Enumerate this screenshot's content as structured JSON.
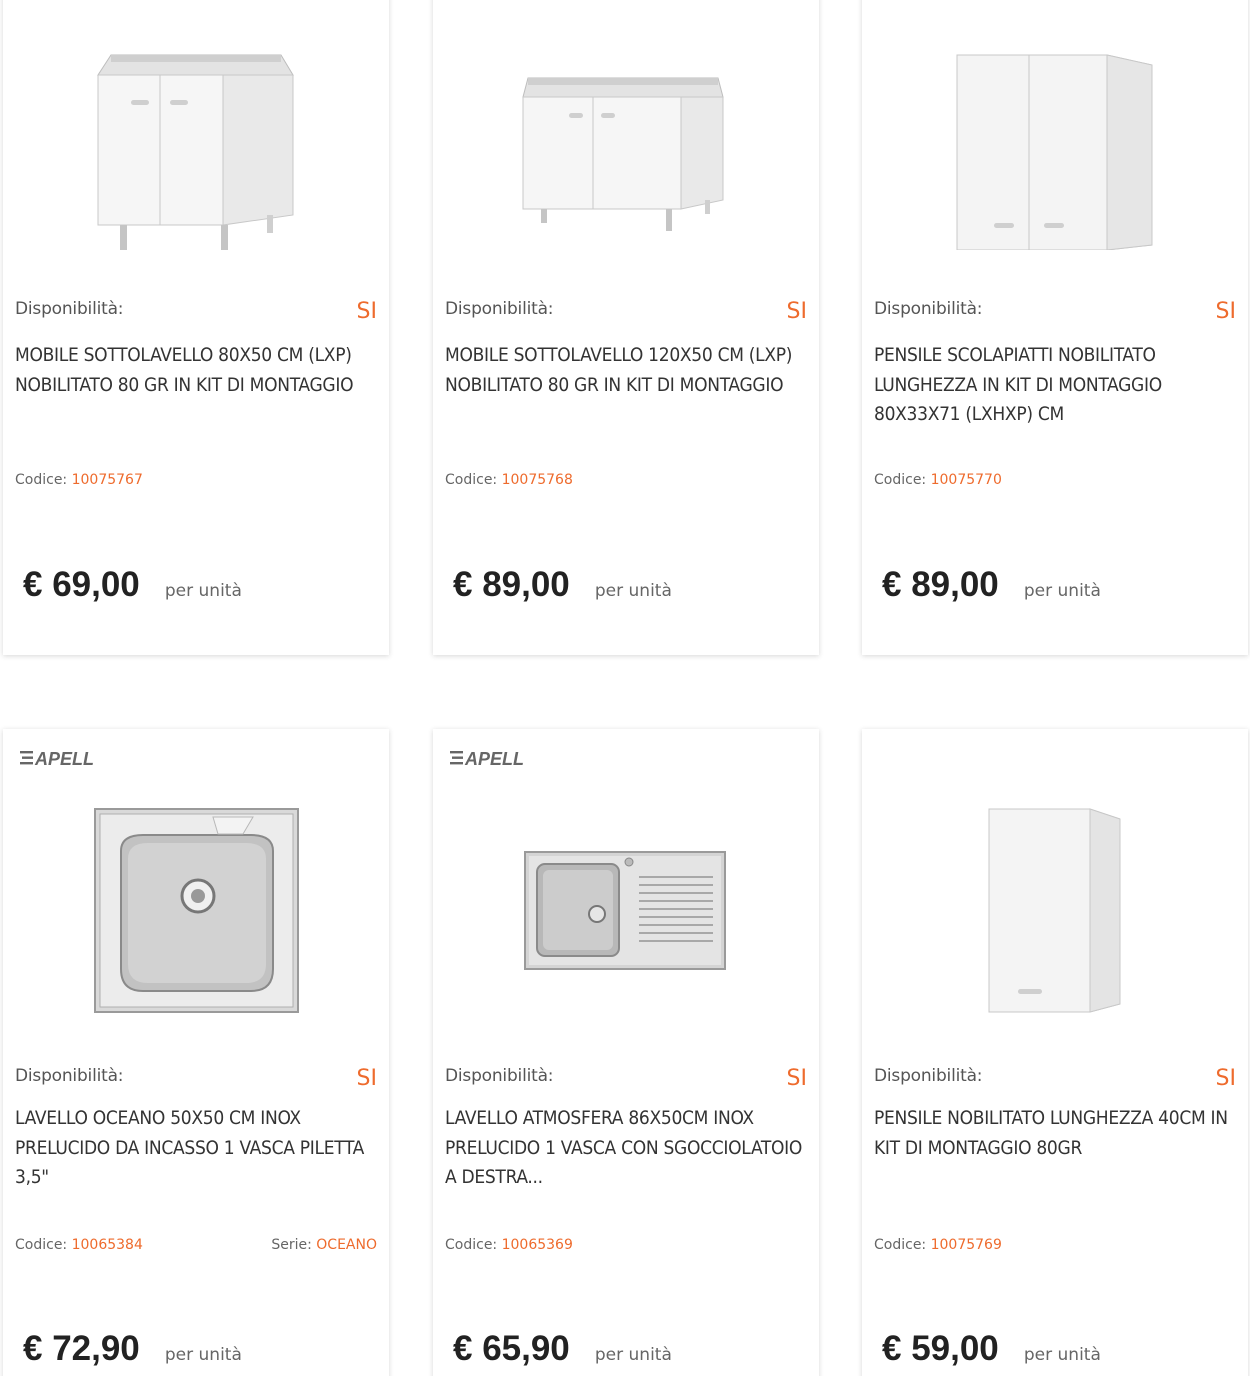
{
  "products": [
    {
      "availability_label": "Disponibilità:",
      "availability_value": "SI",
      "title": "MOBILE SOTTOLAVELLO 80X50 CM (LXP) NOBILITATO 80 GR IN KIT DI MONTAGGIO",
      "code_label": "Codice:",
      "code": "10075767",
      "price": "€ 69,00",
      "unit": "per unità"
    },
    {
      "availability_label": "Disponibilità:",
      "availability_value": "SI",
      "title": "MOBILE SOTTOLAVELLO 120X50 CM (LXP) NOBILITATO 80 GR IN KIT DI MONTAGGIO",
      "code_label": "Codice:",
      "code": "10075768",
      "price": "€ 89,00",
      "unit": "per unità"
    },
    {
      "availability_label": "Disponibilità:",
      "availability_value": "SI",
      "title": "PENSILE SCOLAPIATTI NOBILITATO LUNGHEZZA IN KIT DI MONTAGGIO 80X33X71 (LXHXP) CM",
      "code_label": "Codice:",
      "code": "10075770",
      "price": "€ 89,00",
      "unit": "per unità"
    },
    {
      "brand": "APELL",
      "availability_label": "Disponibilità:",
      "availability_value": "SI",
      "title": "LAVELLO OCEANO 50X50 CM INOX PRELUCIDO DA INCASSO 1 VASCA PILETTA 3,5\"",
      "code_label": "Codice:",
      "code": "10065384",
      "series_label": "Serie:",
      "series": "OCEANO",
      "price": "€ 72,90",
      "unit": "per unità"
    },
    {
      "brand": "APELL",
      "availability_label": "Disponibilità:",
      "availability_value": "SI",
      "title": "LAVELLO ATMOSFERA 86X50CM INOX PRELUCIDO 1 VASCA CON SGOCCIOLATOIO A DESTRA...",
      "code_label": "Codice:",
      "code": "10065369",
      "price": "€ 65,90",
      "unit": "per unità"
    },
    {
      "availability_label": "Disponibilità:",
      "availability_value": "SI",
      "title": "PENSILE NOBILITATO LUNGHEZZA 40CM IN KIT DI MONTAGGIO 80GR",
      "code_label": "Codice:",
      "code": "10075769",
      "price": "€ 59,00",
      "unit": "per unità"
    }
  ],
  "colors": {
    "accent": "#ee6b2d",
    "text": "#333333",
    "muted": "#666666"
  }
}
